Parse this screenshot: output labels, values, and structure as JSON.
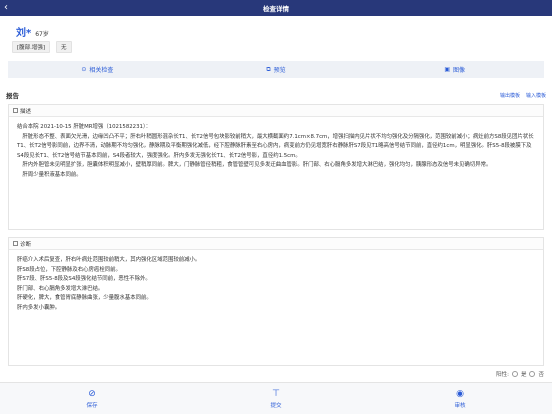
{
  "header": {
    "title": "检查详情",
    "back_icon": "chevron-left-icon"
  },
  "patient": {
    "name": "刘*",
    "age": "67岁"
  },
  "tags": [
    "[腹部.增强]",
    "无"
  ],
  "actions": [
    {
      "label": "相关检查",
      "icon": "link-icon"
    },
    {
      "label": "预览",
      "icon": "preview-icon"
    },
    {
      "label": "图像",
      "icon": "image-icon"
    }
  ],
  "report": {
    "label": "报告",
    "export_template": "输出模板",
    "import_template": "输入模板",
    "description": {
      "title": "描述",
      "lines": [
        "结合本院 2021-10-15 肝脏MR增强（1021582231）：",
        "　肝脏形态不整、表面欠光滑，边缘凹凸不平；肝右叶稍圆形混杂长T1、长T2信号包块影较前稍大，最大横截面约7.1cm×8.7cm，增强扫描内见片状不均匀强化及分隔强化，范围较前减小；病灶前方S8段见团片状长T1、长T2信号影同前，边界不清，动脉期不均匀强化，静脉期及平衡期强化减低，经下腔静脉肝素至右心房内，病变前方仍见增宽肝右静脉肝S7段见T1略高信号结节同前，直径约1cm，明显强化。肝S5-8段被膜下及S4段见长T1、长T2信号结节基本同前，S4段者较大，强度强化。肝内多发无强化长T1、长T2信号影，直径约1.5cm。",
        "　肝内外胆管未见明显扩张，胆囊体积明显减小，壁稍厚同前。脾大，门静脉管径稍粗，食管管壁可见多发迂曲血管影。肝门部、右心膈角多发增大淋巴结，强化均匀，胰腺形态及信号未见确切异常。",
        "　肝周少量积液基本同前。"
      ]
    },
    "diagnosis": {
      "title": "诊断",
      "lines": [
        "肝癌介入术后复查，肝右叶病灶范围较前稍大，其内强化区域范围较前减小。",
        "肝S8段占位，下腔静脉及右心房癌栓同前。",
        "肝S7段、肝S5-8段及S4段强化结节同前，恶性不除外。",
        "肝门部、右心膈角多发增大淋巴结。",
        "肝硬化，脾大，食管胃底静脉曲张，少量腹水基本同前。",
        "肝内多发小囊肿。"
      ]
    },
    "positive": {
      "label": "阳性:",
      "options": [
        "是",
        "否"
      ]
    }
  },
  "bottom": [
    {
      "label": "保存",
      "icon": "check-circle-icon"
    },
    {
      "label": "提交",
      "icon": "submit-icon"
    },
    {
      "label": "审核",
      "icon": "eye-icon"
    }
  ]
}
